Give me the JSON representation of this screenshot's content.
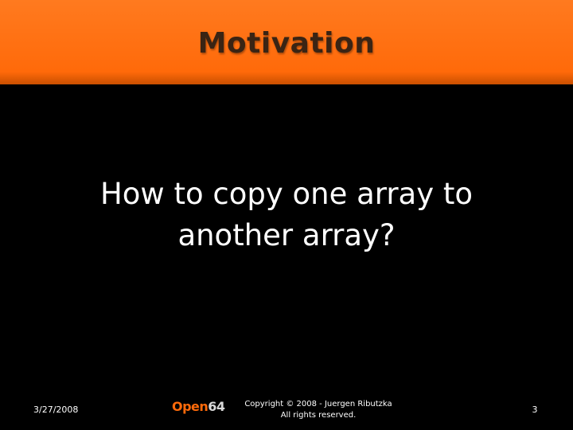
{
  "slide": {
    "title": "Motivation",
    "body_lines": [
      "How to copy one array to",
      "another array?"
    ]
  },
  "footer": {
    "date": "3/27/2008",
    "logo_part1": "Open",
    "logo_part2": "64",
    "copyright_line1": "Copyright © 2008 - Juergen Ributzka",
    "copyright_line2": "All rights reserved.",
    "page_number": "3"
  },
  "colors": {
    "title_bar": "#ff6a0a",
    "background": "#000000",
    "title_text": "#3a2414",
    "body_text": "#ffffff"
  }
}
